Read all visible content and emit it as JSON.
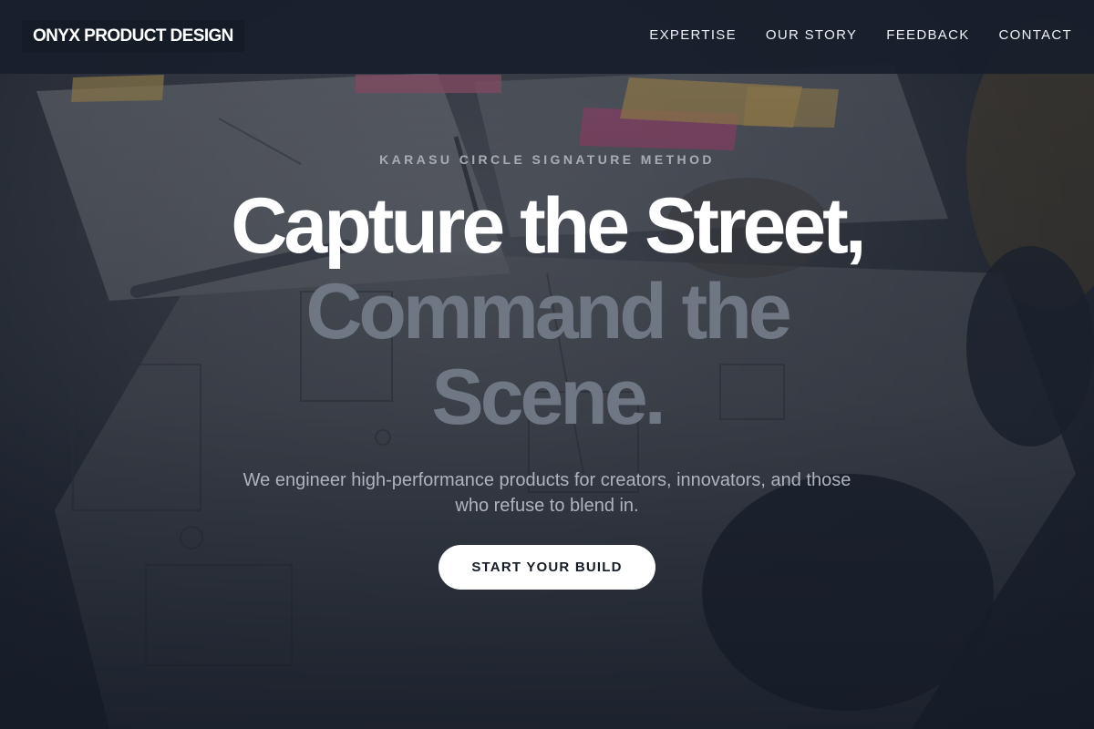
{
  "header": {
    "logo": "ONYX PRODUCT DESIGN",
    "nav": [
      "EXPERTISE",
      "OUR STORY",
      "FEEDBACK",
      "CONTACT"
    ]
  },
  "hero": {
    "eyebrow": "KARASU CIRCLE SIGNATURE METHOD",
    "headline_line1": "Capture the Street,",
    "headline_line2": "Command the",
    "headline_line3": "Scene.",
    "subtitle": "We engineer high-performance products for creators, innovators, and those who refuse to blend in.",
    "cta_label": "START YOUR BUILD"
  },
  "colors": {
    "background": "#151b27",
    "headline_primary": "#ffffff",
    "headline_muted": "#6f7684",
    "cta_background": "#ffffff"
  },
  "background_image": "sketch-paper-desk-photo"
}
